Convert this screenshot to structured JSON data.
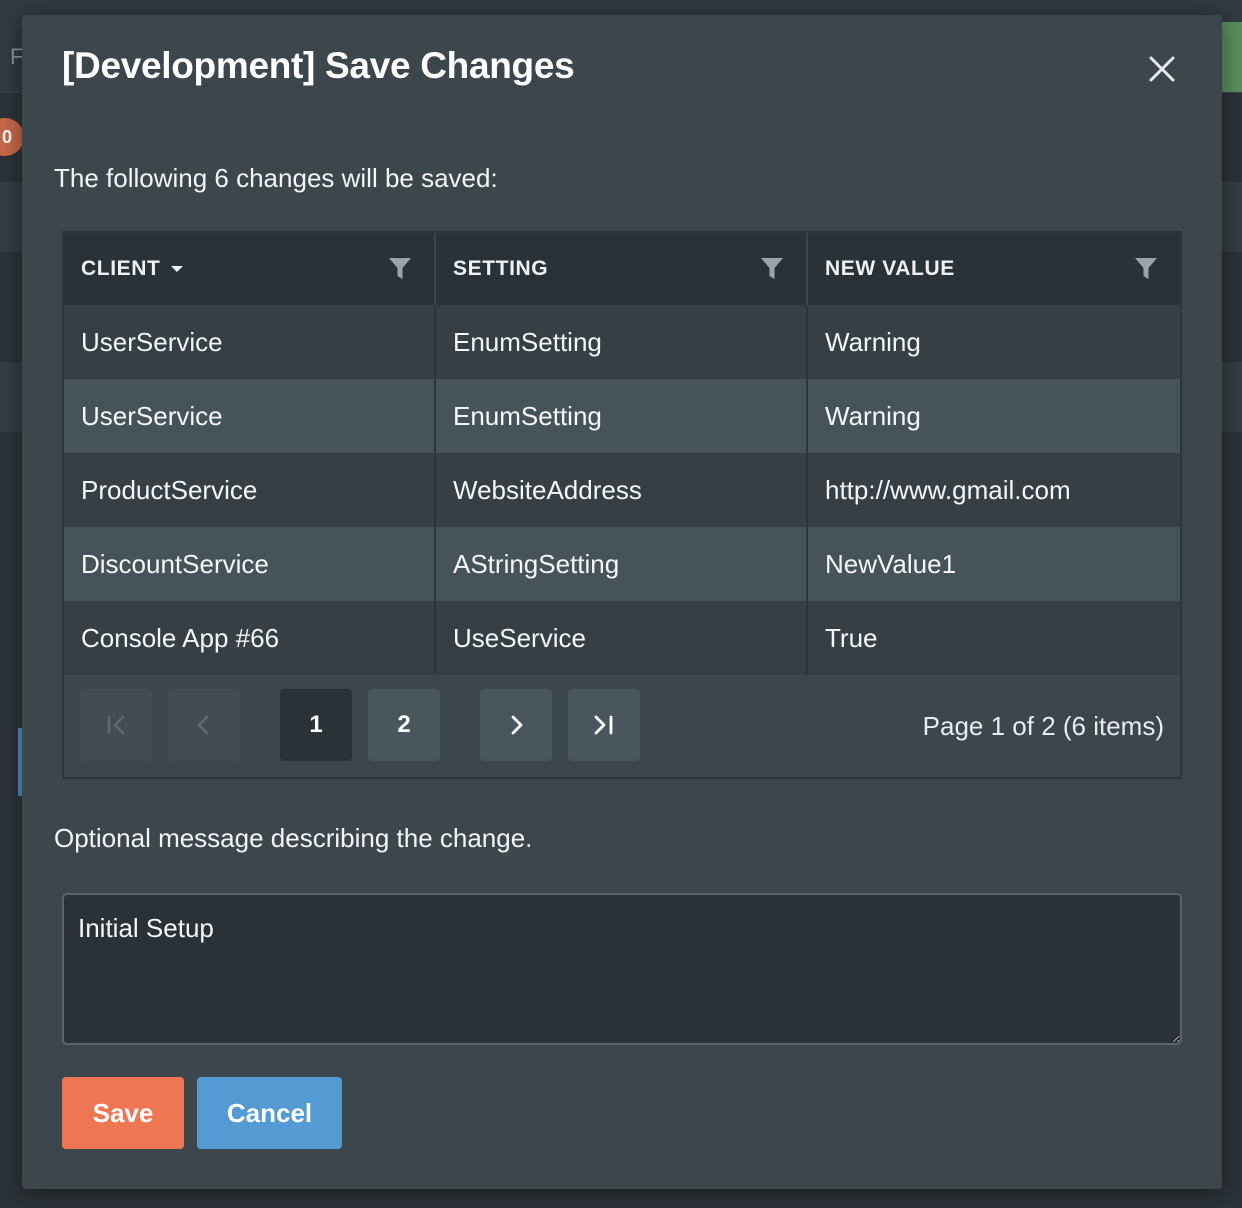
{
  "background": {
    "letter": "F",
    "badge": "0"
  },
  "modal": {
    "title": "[Development] Save Changes",
    "intro": "The following 6 changes will be saved:",
    "grid": {
      "columns": [
        "CLIENT",
        "SETTING",
        "NEW VALUE"
      ],
      "rows": [
        [
          "UserService",
          "EnumSetting",
          "Warning"
        ],
        [
          "UserService",
          "EnumSetting",
          "Warning"
        ],
        [
          "ProductService",
          "WebsiteAddress",
          "http://www.gmail.com"
        ],
        [
          "DiscountService",
          "AStringSetting",
          "NewValue1"
        ],
        [
          "Console App #66",
          "UseService",
          "True"
        ]
      ],
      "pager": {
        "pages": [
          "1",
          "2"
        ],
        "current_page": "1",
        "info": "Page 1 of 2 (6 items)"
      }
    },
    "message_label": "Optional message describing the change.",
    "message_value": "Initial Setup",
    "save_label": "Save",
    "cancel_label": "Cancel"
  },
  "colors": {
    "save": "#ef7652",
    "cancel": "#539bd2",
    "modal_bg": "#3c464d",
    "header_bg": "#2a3238"
  }
}
